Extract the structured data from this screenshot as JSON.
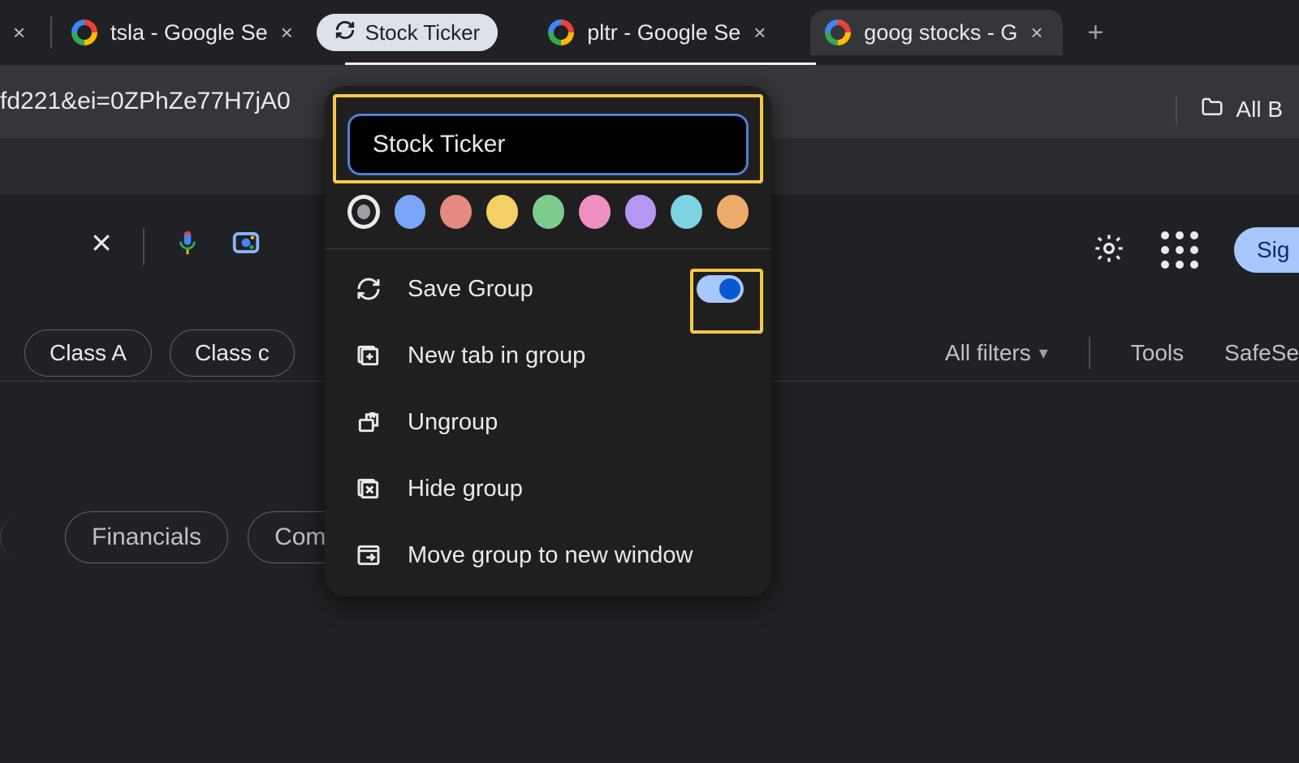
{
  "tabs": {
    "items": [
      {
        "title": "tsla - Google Se"
      },
      {
        "title": "pltr - Google Se"
      },
      {
        "title": "goog stocks - G"
      }
    ],
    "group_pill": "Stock Ticker"
  },
  "address": {
    "url_fragment": "fd221&ei=0ZPhZe77H7jA0"
  },
  "bookmarks": {
    "all_label": "All B"
  },
  "search": {
    "filters": {
      "chips": [
        "Class A",
        "Class c"
      ],
      "all_filters": "All filters",
      "tools": "Tools",
      "safesearch": "SafeSe"
    },
    "bottom_chips": [
      "Financials",
      "Compare"
    ]
  },
  "signin": {
    "label": "Sig"
  },
  "group_menu": {
    "name_value": "Stock Ticker",
    "colors": [
      "#9aa0a6",
      "#7aa5f8",
      "#e58a7f",
      "#f3cf65",
      "#7ecb8f",
      "#ef8fc0",
      "#b497f4",
      "#7cd3e2",
      "#eeab6a"
    ],
    "selected_color_index": 0,
    "items": {
      "save": "Save Group",
      "new_tab": "New tab in group",
      "ungroup": "Ungroup",
      "hide": "Hide group",
      "move": "Move group to new window"
    },
    "save_toggle_on": true
  }
}
